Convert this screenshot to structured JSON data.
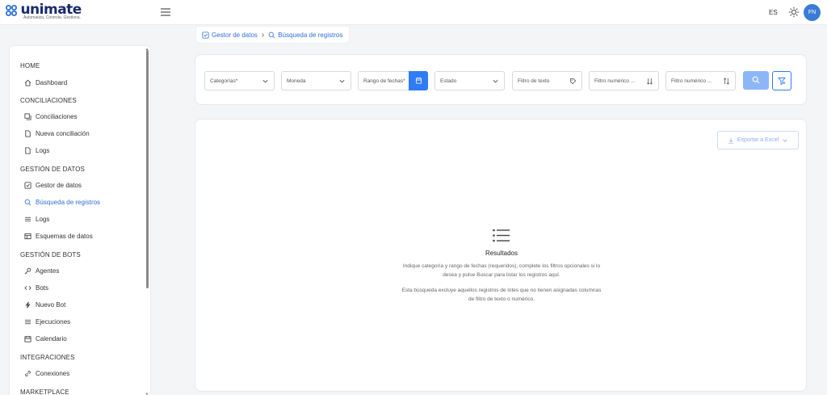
{
  "header": {
    "logo_text": "unimate",
    "logo_tagline": "Automatiza. Controla. Gestiona.",
    "language": "ES",
    "avatar_initials": "FN",
    "accent_color": "#3a7bd5"
  },
  "sidebar": {
    "sections": [
      {
        "title": "HOME",
        "items": [
          {
            "label": "Dashboard",
            "icon": "home-icon"
          }
        ]
      },
      {
        "title": "CONCILIACIONES",
        "items": [
          {
            "label": "Conciliaciones",
            "icon": "copy-icon"
          },
          {
            "label": "Nueva conciliación",
            "icon": "file-icon"
          },
          {
            "label": "Logs",
            "icon": "file-icon"
          }
        ]
      },
      {
        "title": "GESTIÓN DE DATOS",
        "items": [
          {
            "label": "Gestor de datos",
            "icon": "checkbox-icon"
          },
          {
            "label": "Búsqueda de registros",
            "icon": "search-icon",
            "active": true
          },
          {
            "label": "Logs",
            "icon": "list-icon"
          },
          {
            "label": "Esquemas de datos",
            "icon": "table-icon"
          }
        ]
      },
      {
        "title": "GESTIÓN DE BOTS",
        "items": [
          {
            "label": "Agentes",
            "icon": "key-icon"
          },
          {
            "label": "Bots",
            "icon": "code-icon"
          },
          {
            "label": "Nuevo Bot",
            "icon": "bolt-icon"
          },
          {
            "label": "Ejecuciones",
            "icon": "list-icon"
          },
          {
            "label": "Calendario",
            "icon": "calendar-icon"
          }
        ]
      },
      {
        "title": "INTEGRACIONES",
        "items": [
          {
            "label": "Conexiones",
            "icon": "link-icon"
          }
        ]
      },
      {
        "title": "MARKETPLACE",
        "items": []
      }
    ]
  },
  "breadcrumb": {
    "parent": "Gestor de datos",
    "current": "Búsqueda de registros"
  },
  "filters": {
    "categorias": "Categorías*",
    "moneda": "Moneda",
    "rango_fechas": "Rango de fechas*",
    "estado": "Estado",
    "filtro_texto": "Filtro de texto",
    "filtro_numerico_1": "Filtro numérico ...",
    "filtro_numerico_2": "Filtro numérico ..."
  },
  "results": {
    "export_label": "Exportar a Excel",
    "title": "Resultados",
    "desc_line1": "Indique categoría y rango de fechas (requeridos), complete los filtros opcionales si lo",
    "desc_line2": "desea y pulse Buscar para listar los registros aquí.",
    "note_line1": "Esta búsqueda excluye aquellos registros de lotes que no tienen asignadas columnas",
    "note_line2": "de filtro de texto o numérico."
  }
}
